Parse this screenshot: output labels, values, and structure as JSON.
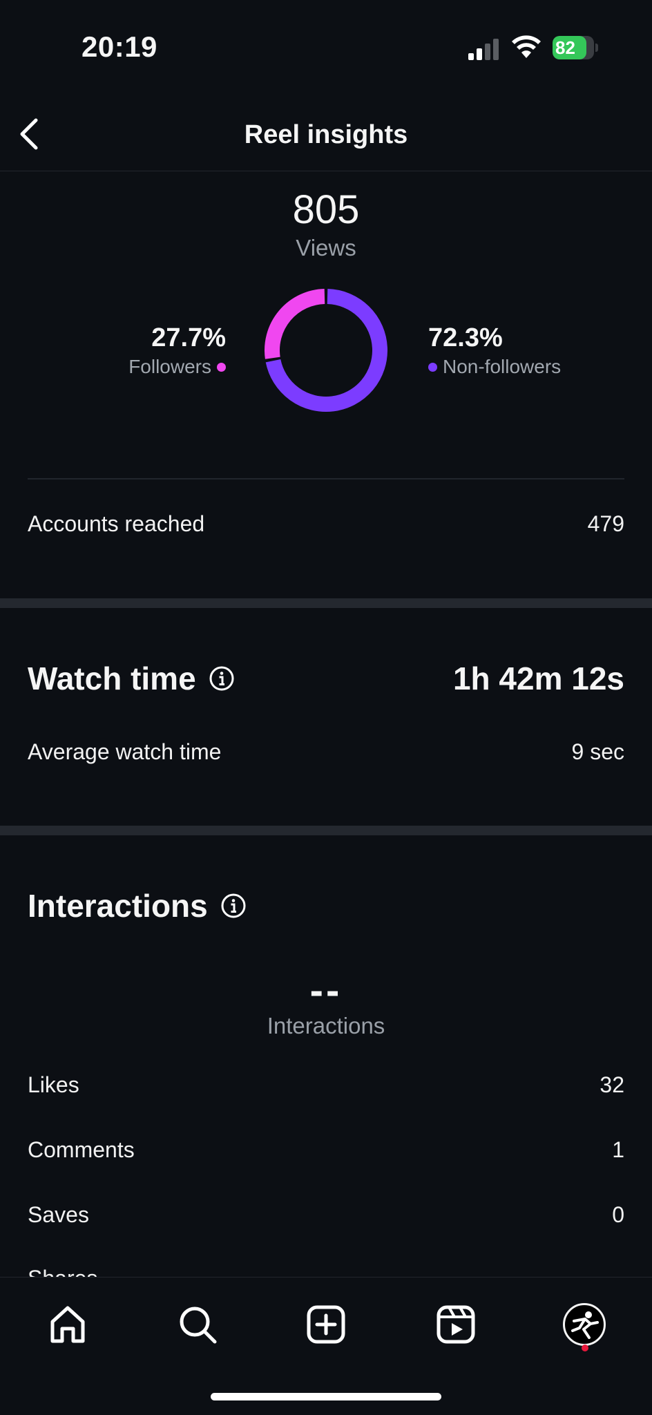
{
  "status_bar": {
    "time": "20:19",
    "battery": "82",
    "battery_level": 0.82,
    "battery_color": "#34c759"
  },
  "header": {
    "title": "Reel insights"
  },
  "views": {
    "count": "805",
    "label": "Views",
    "followers": {
      "pct": "27.7%",
      "label": "Followers",
      "value": 27.7,
      "color": "#f047f0"
    },
    "non_followers": {
      "pct": "72.3%",
      "label": "Non-followers",
      "value": 72.3,
      "color": "#7c3cff"
    }
  },
  "reach": {
    "label": "Accounts reached",
    "value": "479"
  },
  "watch_time": {
    "title": "Watch time",
    "total": "1h 42m 12s",
    "avg_label": "Average watch time",
    "avg_value": "9 sec"
  },
  "interactions": {
    "title": "Interactions",
    "total": "--",
    "total_label": "Interactions",
    "rows": [
      {
        "label": "Likes",
        "value": "32"
      },
      {
        "label": "Comments",
        "value": "1"
      },
      {
        "label": "Saves",
        "value": "0"
      }
    ],
    "partial_label": "Shares"
  },
  "tab_bar": {
    "items": [
      "home-icon",
      "search-icon",
      "create-icon",
      "reels-icon",
      "profile-avatar"
    ],
    "notification_color": "#e8193c"
  }
}
